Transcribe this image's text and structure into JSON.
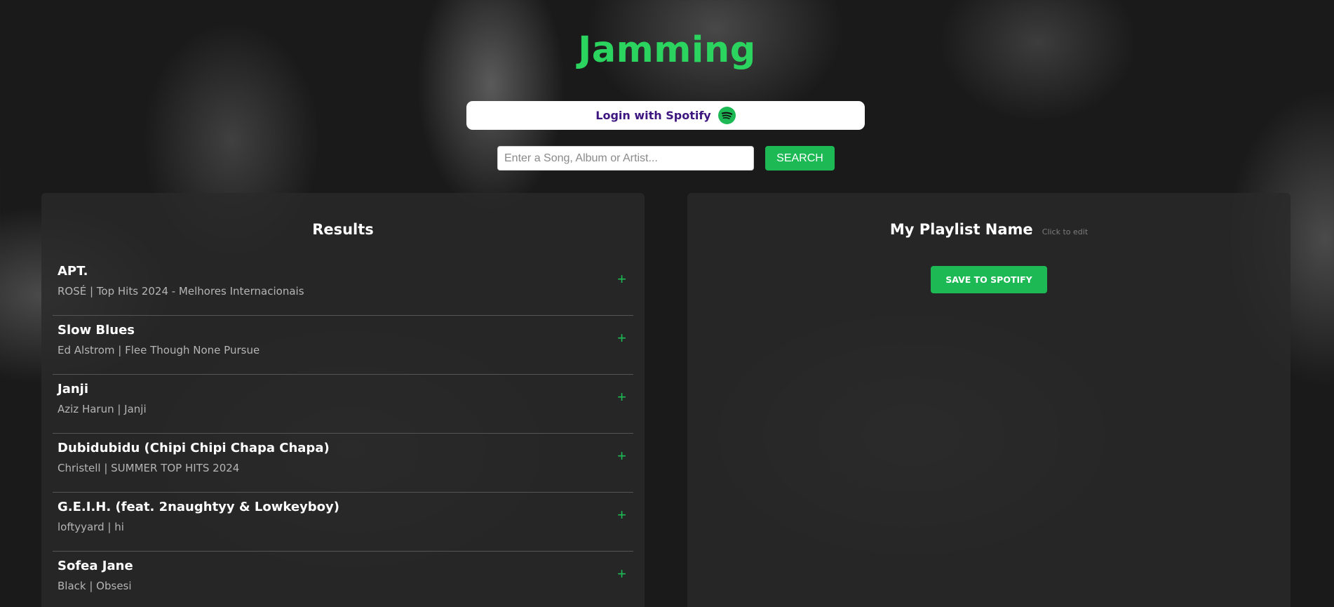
{
  "app": {
    "title": "Jamming"
  },
  "login": {
    "label": "Login with Spotify",
    "icon": "spotify-logo-icon"
  },
  "search": {
    "placeholder": "Enter a Song, Album or Artist...",
    "value": "",
    "button_label": "SEARCH"
  },
  "results": {
    "heading": "Results",
    "tracks": [
      {
        "name": "APT.",
        "info": "ROSÉ | Top Hits 2024 - Melhores Internacionais",
        "action": "+"
      },
      {
        "name": "Slow Blues",
        "info": "Ed Alstrom | Flee Though None Pursue",
        "action": "+"
      },
      {
        "name": "Janji",
        "info": "Aziz Harun | Janji",
        "action": "+"
      },
      {
        "name": "Dubidubidu (Chipi Chipi Chapa Chapa)",
        "info": "Christell | SUMMER TOP HITS 2024",
        "action": "+"
      },
      {
        "name": "G.E.I.H. (feat. 2naughtyy & Lowkeyboy)",
        "info": "loftyyard | hi",
        "action": "+"
      },
      {
        "name": "Sofea Jane",
        "info": "Black | Obsesi",
        "action": "+"
      }
    ]
  },
  "playlist": {
    "name": "My Playlist Name",
    "edit_hint": "Click to edit",
    "save_label": "SAVE TO SPOTIFY"
  },
  "colors": {
    "accent": "#1db954",
    "title": "#2bd45f",
    "login_text": "#3d1680",
    "panel": "#2a2a2a"
  }
}
